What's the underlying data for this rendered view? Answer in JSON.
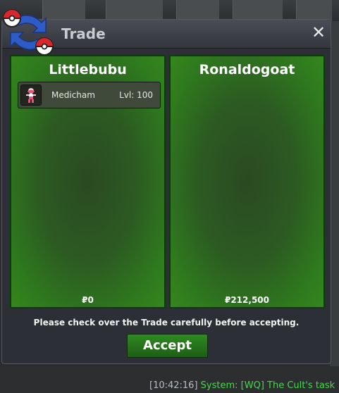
{
  "window": {
    "title": "Trade",
    "close_symbol": "✕"
  },
  "left_panel": {
    "player": "Littlebubu",
    "items": [
      {
        "name": "Medicham",
        "level": "Lvl: 100",
        "icon": "medicham-sprite-icon"
      }
    ],
    "money": "₽0"
  },
  "right_panel": {
    "player": "Ronaldogoat",
    "items": [],
    "money": "₽212,500"
  },
  "notice": "Please check over the Trade carefully before accepting.",
  "accept_label": "Accept",
  "chat": {
    "timestamp": "[10:42:16]",
    "message": "System: [WQ] The Cult's task"
  },
  "colors": {
    "panel_green": "#2f7a1e",
    "accept_green": "#2f8a22",
    "chat_green": "#46d84b"
  }
}
